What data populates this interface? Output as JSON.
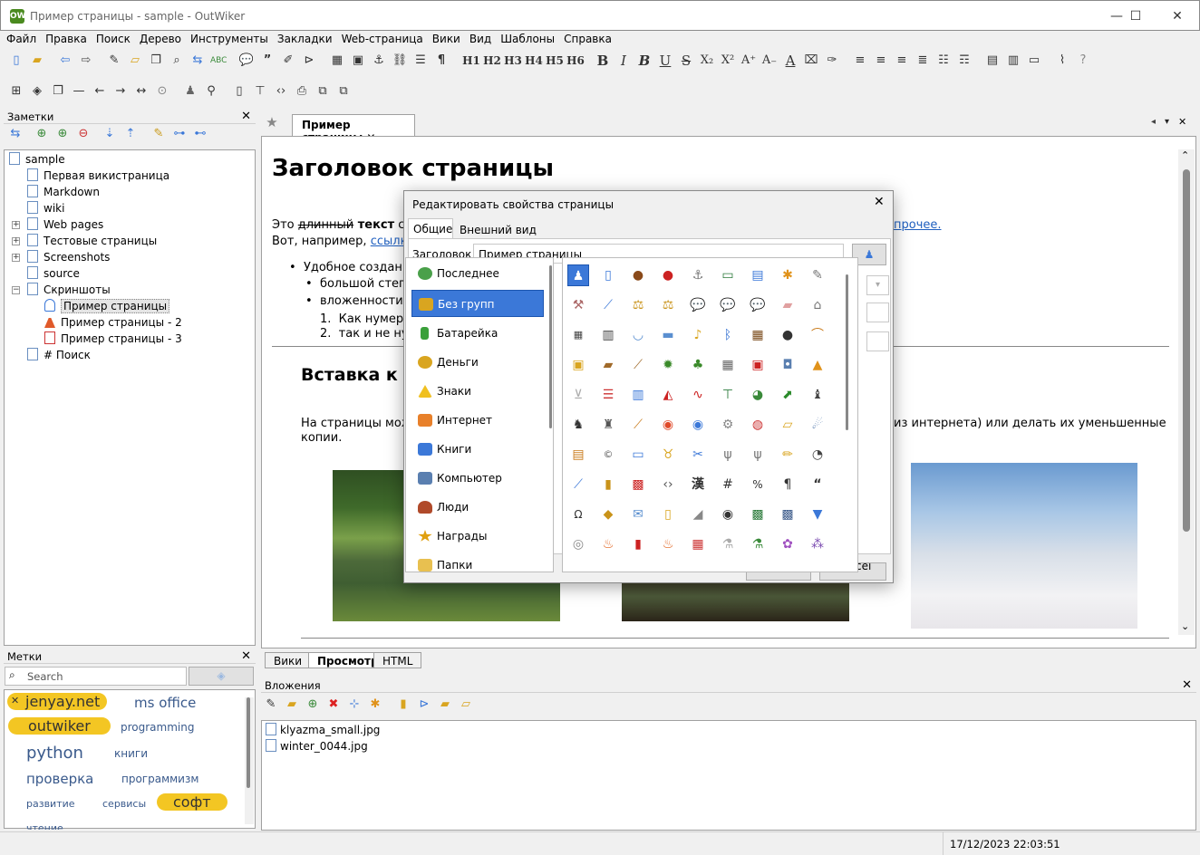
{
  "window": {
    "title": "Пример страницы - sample - OutWiker",
    "logo": "OW",
    "minimize": "—",
    "maximize": "☐",
    "close": "✕"
  },
  "menu": [
    "Файл",
    "Правка",
    "Поиск",
    "Дерево",
    "Инструменты",
    "Закладки",
    "Web-страница",
    "Вики",
    "Вид",
    "Шаблоны",
    "Справка"
  ],
  "toolbar": {
    "headings": [
      "H1",
      "H2",
      "H3",
      "H4",
      "H5",
      "H6"
    ],
    "formatting": [
      "B",
      "I",
      "B",
      "U",
      "S",
      "X₂",
      "X²",
      "A⁺",
      "A₋",
      "A"
    ]
  },
  "notes_panel": {
    "title": "Заметки",
    "tree": [
      {
        "label": "sample",
        "depth": 0
      },
      {
        "label": "Первая викистраница",
        "depth": 1
      },
      {
        "label": "Markdown",
        "depth": 1
      },
      {
        "label": "wiki",
        "depth": 1
      },
      {
        "label": "Web pages",
        "depth": 1
      },
      {
        "label": "Тестовые страницы",
        "depth": 1
      },
      {
        "label": "Screenshots",
        "depth": 1
      },
      {
        "label": "source",
        "depth": 1
      },
      {
        "label": "Скриншоты",
        "depth": 1
      },
      {
        "label": "Пример страницы",
        "depth": 2
      },
      {
        "label": "Пример страницы - 2",
        "depth": 2
      },
      {
        "label": "Пример страницы - 3",
        "depth": 2
      },
      {
        "label": "# Поиск",
        "depth": 1
      }
    ]
  },
  "tags_panel": {
    "title": "Метки",
    "search_placeholder": "Search",
    "tags": [
      {
        "label": "jenyay.net",
        "highlight": true
      },
      {
        "label": "ms office",
        "highlight": false
      },
      {
        "label": "outwiker",
        "highlight": true
      },
      {
        "label": "programming",
        "highlight": false
      },
      {
        "label": "python",
        "highlight": false
      },
      {
        "label": "книги",
        "highlight": false
      },
      {
        "label": "проверка",
        "highlight": false
      },
      {
        "label": "программизм",
        "highlight": false
      },
      {
        "label": "развитие",
        "highlight": false
      },
      {
        "label": "сервисы",
        "highlight": false
      },
      {
        "label": "софт",
        "highlight": true
      },
      {
        "label": "чтение",
        "highlight": false
      }
    ],
    "tag_remove": "✕"
  },
  "editor": {
    "tab_label": "Пример страницы",
    "tab_close": "✕",
    "heading": "Заголовок страницы",
    "para_start": "Это ",
    "para_strike": "длинный",
    "para_bold": " текст",
    "para_rest": " с",
    "para_end": "прочее.",
    "line2_start": "Вот, например, ",
    "line2_link": "ссылк",
    "bullet1": "Удобное создан",
    "sub1": "большой степ",
    "sub2": "вложенности",
    "num1": "Как нумер",
    "num2": "так и не ну",
    "section": "Вставка к",
    "body_start": "На страницы мож",
    "body_end": "из интернета) или делать их уменьшенные",
    "body_end2": "копии.",
    "view_tabs": [
      "Вики",
      "Просмотр",
      "HTML"
    ]
  },
  "attachments": {
    "title": "Вложения",
    "files": [
      "klyazma_small.jpg",
      "winter_0044.jpg"
    ]
  },
  "dialog": {
    "title": "Редактировать свойства страницы",
    "close": "✕",
    "tabs": [
      "Общие",
      "Внешний вид"
    ],
    "field_label": "Заголовок",
    "field_value": "Пример страницы",
    "categories": [
      "Последнее",
      "Без групп",
      "Батарейка",
      "Деньги",
      "Знаки",
      "Интернет",
      "Книги",
      "Компьютер",
      "Люди",
      "Награды",
      "Папки"
    ],
    "active_category": "Без групп",
    "ok": "OK",
    "cancel": "Cancel"
  },
  "status": {
    "datetime": "17/12/2023 22:03:51"
  },
  "colors": {
    "accent": "#3b78d8",
    "tag_highlight": "#f3c623",
    "link": "#1f5fbf"
  }
}
